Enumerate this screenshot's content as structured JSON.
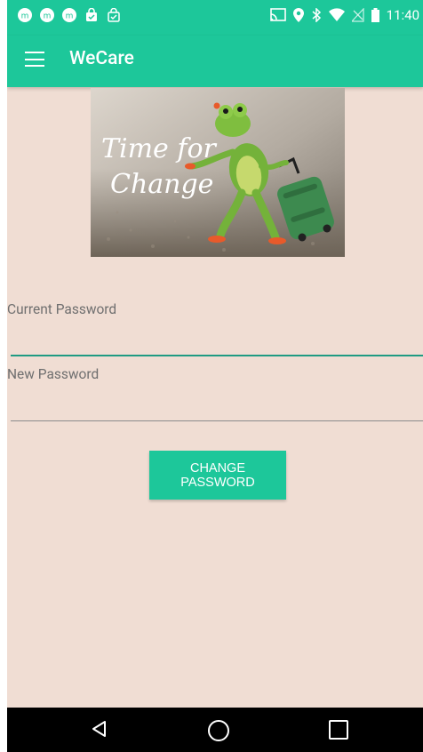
{
  "status": {
    "time": "11:40"
  },
  "app": {
    "title": "WeCare"
  },
  "hero": {
    "text_line1": "Time for",
    "text_line2": "Change"
  },
  "form": {
    "current_label": "Current Password",
    "current_value": "",
    "new_label": "New Password",
    "new_value": ""
  },
  "button": {
    "label": "CHANGE PASSWORD"
  },
  "colors": {
    "accent": "#1dc79a",
    "background": "#f0ddd3",
    "input_active": "#1f9b82"
  }
}
